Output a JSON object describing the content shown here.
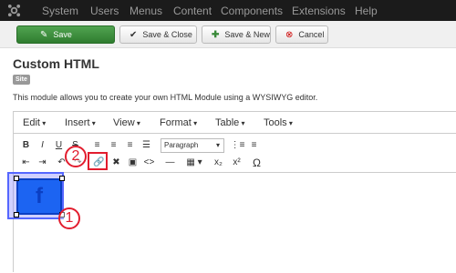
{
  "topbar": {
    "menu": [
      "System",
      "Users",
      "Menus",
      "Content",
      "Components",
      "Extensions",
      "Help"
    ]
  },
  "toolbar": {
    "save_label": "Save",
    "save_close_label": "Save & Close",
    "save_new_label": "Save & New",
    "cancel_label": "Cancel"
  },
  "page": {
    "title": "Custom HTML",
    "badge": "Site",
    "description": "This module allows you to create your own HTML Module using a WYSIWYG editor."
  },
  "editor": {
    "menubar": [
      "Edit",
      "Insert",
      "View",
      "Format",
      "Table",
      "Tools"
    ],
    "format_select": "Paragraph",
    "buttons": {
      "bold": "B",
      "italic": "I",
      "underline": "U",
      "strike": "S",
      "subscript": "x₂",
      "superscript": "x²",
      "omega": "Ω"
    }
  },
  "annotations": {
    "marker1": "1",
    "marker2": "2"
  },
  "colors": {
    "topbar": "#1b1b1b",
    "save": "#2f7d2f",
    "annotation": "#e21d2e",
    "selection": "#5566ff",
    "image": "#1c64f2"
  }
}
